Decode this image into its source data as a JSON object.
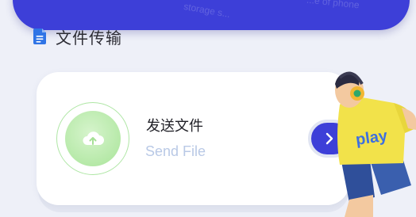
{
  "banner": {
    "faint_text_1": "storage s...",
    "faint_text_2": "...e of phone"
  },
  "section": {
    "title": "文件传输",
    "icon": "document-icon"
  },
  "send_card": {
    "title": "发送文件",
    "subtitle": "Send File",
    "upload_icon": "cloud-upload-icon",
    "arrow_icon": "chevron-right-icon"
  },
  "mascot": {
    "shirt_text": "play",
    "colors": {
      "shirt": "#f2e24a",
      "shorts": "#2f4f9a",
      "skin": "#f3c9a0"
    }
  },
  "colors": {
    "accent": "#3d3fd8",
    "page_bg": "#eef0f8",
    "upload_green": "#b6e9a8",
    "subtitle": "#b9c9e6"
  }
}
